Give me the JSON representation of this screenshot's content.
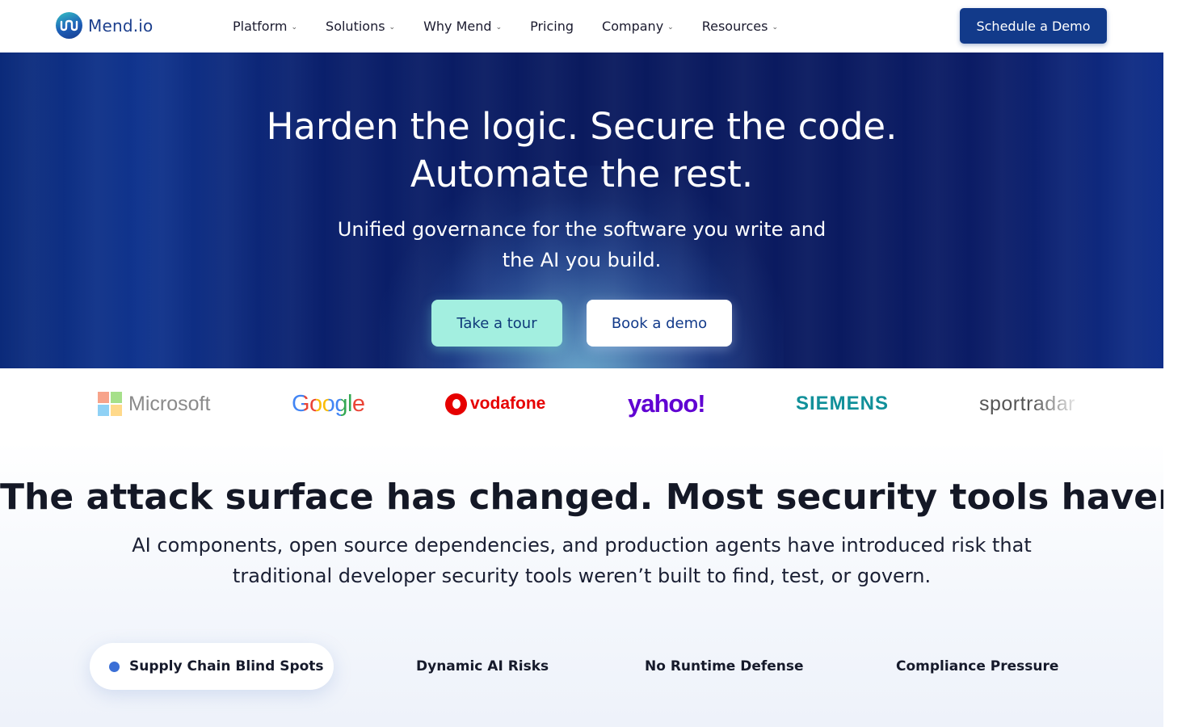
{
  "header": {
    "logo_text": "Mend.io",
    "nav": [
      {
        "label": "Platform",
        "has_dropdown": true
      },
      {
        "label": "Solutions",
        "has_dropdown": true
      },
      {
        "label": "Why Mend",
        "has_dropdown": true
      },
      {
        "label": "Pricing",
        "has_dropdown": false
      },
      {
        "label": "Company",
        "has_dropdown": true
      },
      {
        "label": "Resources",
        "has_dropdown": true
      }
    ],
    "cta_label": "Schedule a Demo"
  },
  "hero": {
    "title_line1": "Harden the logic. Secure the code.",
    "title_line2": "Automate the rest.",
    "subtitle_line1": "Unified governance for the software you write and",
    "subtitle_line2": "the AI you build.",
    "primary_button": "Take a tour",
    "secondary_button": "Book a demo"
  },
  "customer_logos": {
    "microsoft": "Microsoft",
    "google": "Google",
    "vodafone": "vodafone",
    "yahoo": "yahoo!",
    "siemens": "SIEMENS",
    "sportradar": "sportradar"
  },
  "attack_surface": {
    "title_bold": "The attack surface has changed.",
    "title_regular": " Most security tools haven’t.",
    "description_line1": "AI components, open source dependencies, and production agents have introduced risk that",
    "description_line2": "traditional developer security tools weren’t built to find, test, or govern.",
    "tabs": [
      {
        "label": "Supply Chain Blind Spots",
        "active": true
      },
      {
        "label": "Dynamic AI Risks",
        "active": false
      },
      {
        "label": "No Runtime Defense",
        "active": false
      },
      {
        "label": "Compliance Pressure",
        "active": false
      }
    ]
  },
  "colors": {
    "brand_navy": "#123a8a",
    "hero_bg": "#0a1a5e",
    "tour_button": "#a3efe0",
    "active_dot": "#3b6fd6"
  }
}
